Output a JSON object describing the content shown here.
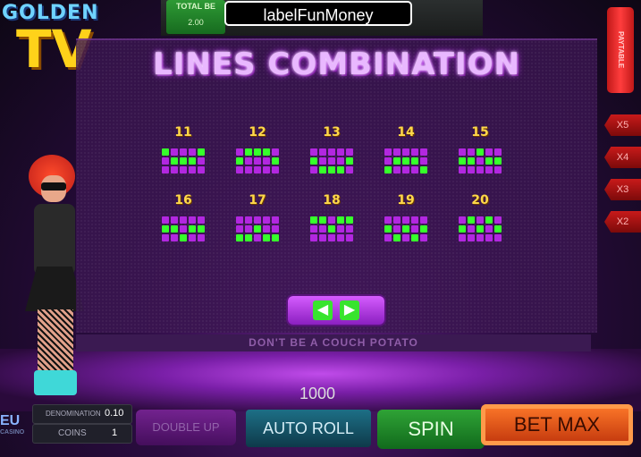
{
  "logo": {
    "line1": "GOLDEN",
    "line2": "TV"
  },
  "top_bar": {
    "total_label": "TOTAL BE",
    "total_value": "2.00",
    "money_label": "labelFunMoney"
  },
  "title": "LINES COMBINATION",
  "lines": [
    {
      "number": "11",
      "pattern": [
        [
          1,
          0,
          0,
          0,
          1
        ],
        [
          0,
          1,
          1,
          1,
          0
        ],
        [
          0,
          0,
          0,
          0,
          0
        ]
      ]
    },
    {
      "number": "12",
      "pattern": [
        [
          0,
          1,
          1,
          1,
          0
        ],
        [
          1,
          0,
          0,
          0,
          1
        ],
        [
          0,
          0,
          0,
          0,
          0
        ]
      ]
    },
    {
      "number": "13",
      "pattern": [
        [
          0,
          0,
          0,
          0,
          0
        ],
        [
          1,
          0,
          0,
          0,
          1
        ],
        [
          0,
          1,
          1,
          1,
          0
        ]
      ]
    },
    {
      "number": "14",
      "pattern": [
        [
          0,
          0,
          0,
          0,
          0
        ],
        [
          0,
          1,
          1,
          1,
          0
        ],
        [
          1,
          0,
          0,
          0,
          1
        ]
      ]
    },
    {
      "number": "15",
      "pattern": [
        [
          0,
          0,
          1,
          0,
          0
        ],
        [
          1,
          1,
          0,
          1,
          1
        ],
        [
          0,
          0,
          0,
          0,
          0
        ]
      ]
    },
    {
      "number": "16",
      "pattern": [
        [
          0,
          0,
          0,
          0,
          0
        ],
        [
          1,
          1,
          0,
          1,
          1
        ],
        [
          0,
          0,
          1,
          0,
          0
        ]
      ]
    },
    {
      "number": "17",
      "pattern": [
        [
          0,
          0,
          0,
          0,
          0
        ],
        [
          0,
          0,
          1,
          0,
          0
        ],
        [
          1,
          1,
          0,
          1,
          1
        ]
      ]
    },
    {
      "number": "18",
      "pattern": [
        [
          1,
          1,
          0,
          1,
          1
        ],
        [
          0,
          0,
          1,
          0,
          0
        ],
        [
          0,
          0,
          0,
          0,
          0
        ]
      ]
    },
    {
      "number": "19",
      "pattern": [
        [
          0,
          0,
          0,
          0,
          0
        ],
        [
          1,
          0,
          1,
          0,
          1
        ],
        [
          0,
          1,
          0,
          1,
          0
        ]
      ]
    },
    {
      "number": "20",
      "pattern": [
        [
          0,
          1,
          0,
          1,
          0
        ],
        [
          1,
          0,
          1,
          0,
          1
        ],
        [
          0,
          0,
          0,
          0,
          0
        ]
      ]
    }
  ],
  "nav": {
    "prev": "◀",
    "next": "▶"
  },
  "tagline": "DON'T BE A COUCH POTATO",
  "credit": "1000",
  "side": {
    "paytable": "PAYTABLE",
    "multipliers": [
      "X5",
      "X4",
      "X3",
      "X2"
    ]
  },
  "hud": {
    "brand": "EU",
    "brand_sub": "CASINO",
    "denomination_label": "DENOMINATION",
    "denomination_value": "0.10",
    "coins_label": "COINS",
    "coins_value": "1"
  },
  "buttons": {
    "double_up": "DOUBLE UP",
    "auto_roll": "AUTO ROLL",
    "spin": "SPIN",
    "bet_max": "BET MAX"
  },
  "colors": {
    "cell_off": "#b227e0",
    "cell_on": "#36ff2b",
    "title": "#e9b8ff",
    "number": "#ffd84a"
  }
}
